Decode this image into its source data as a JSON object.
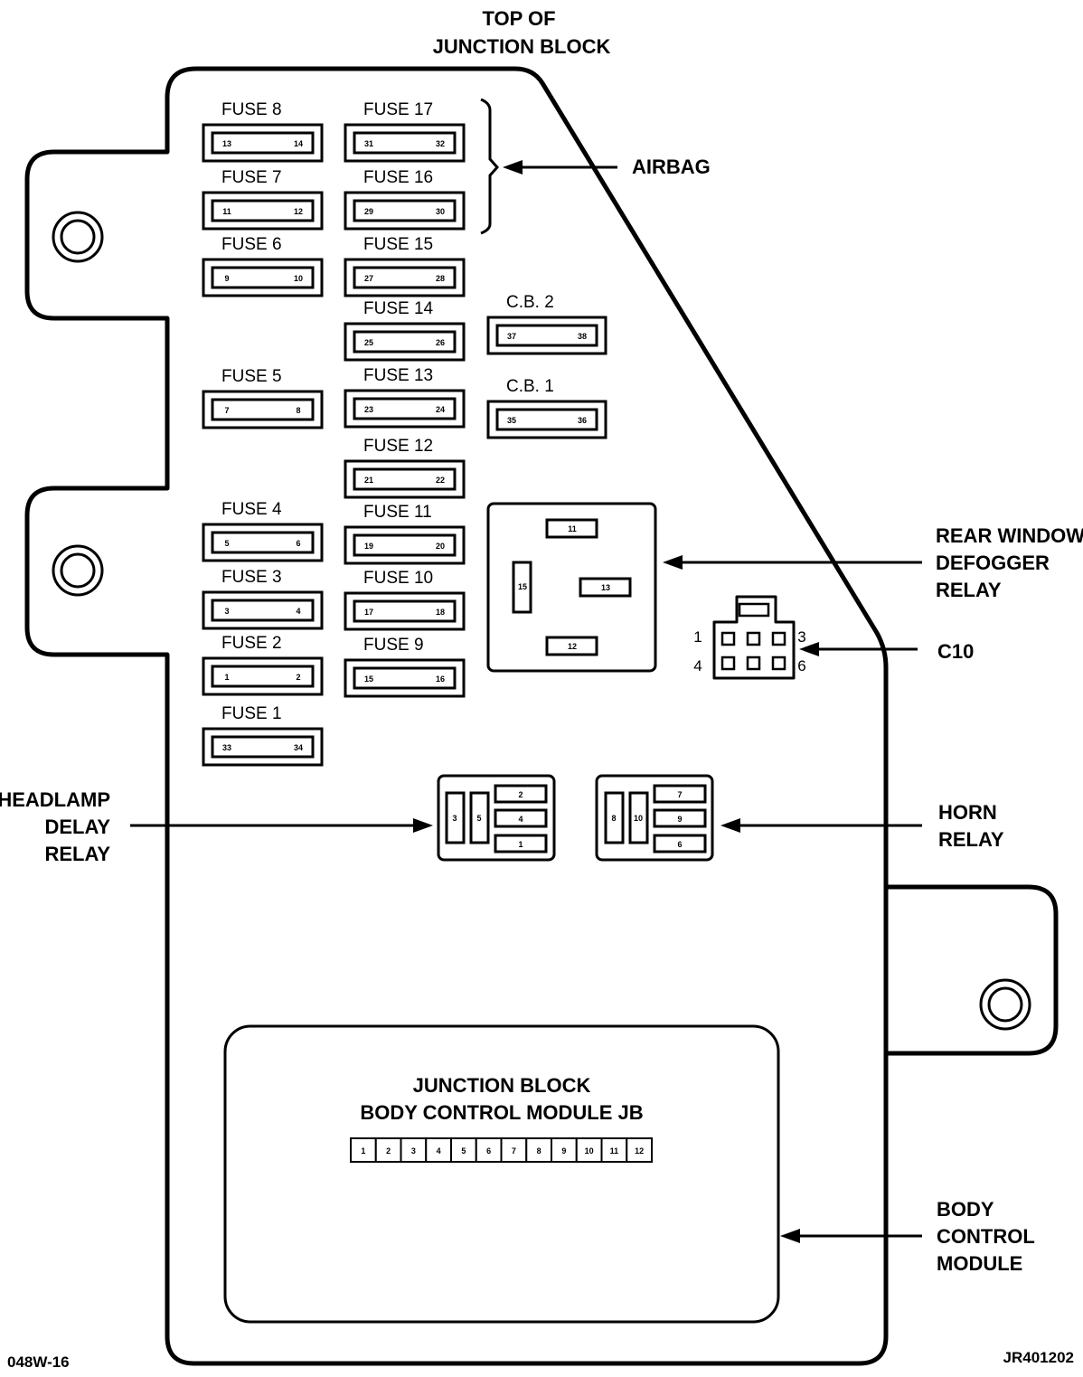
{
  "header": {
    "title_line1": "TOP OF",
    "title_line2": "JUNCTION BLOCK"
  },
  "fuses": [
    {
      "id": "fuse-8",
      "label": "FUSE 8",
      "pins": [
        "13",
        "14"
      ]
    },
    {
      "id": "fuse-7",
      "label": "FUSE 7",
      "pins": [
        "11",
        "12"
      ]
    },
    {
      "id": "fuse-6",
      "label": "FUSE 6",
      "pins": [
        "9",
        "10"
      ]
    },
    {
      "id": "fuse-5",
      "label": "FUSE 5",
      "pins": [
        "7",
        "8"
      ]
    },
    {
      "id": "fuse-4",
      "label": "FUSE 4",
      "pins": [
        "5",
        "6"
      ]
    },
    {
      "id": "fuse-3",
      "label": "FUSE 3",
      "pins": [
        "3",
        "4"
      ]
    },
    {
      "id": "fuse-2",
      "label": "FUSE 2",
      "pins": [
        "1",
        "2"
      ]
    },
    {
      "id": "fuse-1",
      "label": "FUSE 1",
      "pins": [
        "33",
        "34"
      ]
    },
    {
      "id": "fuse-17",
      "label": "FUSE 17",
      "pins": [
        "31",
        "32"
      ]
    },
    {
      "id": "fuse-16",
      "label": "FUSE 16",
      "pins": [
        "29",
        "30"
      ]
    },
    {
      "id": "fuse-15",
      "label": "FUSE 15",
      "pins": [
        "27",
        "28"
      ]
    },
    {
      "id": "fuse-14",
      "label": "FUSE 14",
      "pins": [
        "25",
        "26"
      ]
    },
    {
      "id": "fuse-13",
      "label": "FUSE 13",
      "pins": [
        "23",
        "24"
      ]
    },
    {
      "id": "fuse-12",
      "label": "FUSE 12",
      "pins": [
        "21",
        "22"
      ]
    },
    {
      "id": "fuse-11",
      "label": "FUSE 11",
      "pins": [
        "19",
        "20"
      ]
    },
    {
      "id": "fuse-10",
      "label": "FUSE 10",
      "pins": [
        "17",
        "18"
      ]
    },
    {
      "id": "fuse-9",
      "label": "FUSE 9",
      "pins": [
        "15",
        "16"
      ]
    },
    {
      "id": "cb-2",
      "label": "C.B. 2",
      "pins": [
        "37",
        "38"
      ]
    },
    {
      "id": "cb-1",
      "label": "C.B. 1",
      "pins": [
        "35",
        "36"
      ]
    }
  ],
  "rear_defogger_relay": {
    "pins": {
      "top": "11",
      "left": "15",
      "right": "13",
      "bottom": "12"
    }
  },
  "headlamp_relay": {
    "tall_pins": [
      "3",
      "5"
    ],
    "flat_pins": [
      "2",
      "4",
      "1"
    ]
  },
  "horn_relay": {
    "tall_pins": [
      "8",
      "10"
    ],
    "flat_pins": [
      "7",
      "9",
      "6"
    ]
  },
  "c10": {
    "pin_labels": {
      "top_left": "1",
      "top_right": "3",
      "bottom_left": "4",
      "bottom_right": "6"
    }
  },
  "bcm": {
    "title_line1": "JUNCTION BLOCK",
    "title_line2": "BODY CONTROL MODULE JB",
    "pins": [
      "1",
      "2",
      "3",
      "4",
      "5",
      "6",
      "7",
      "8",
      "9",
      "10",
      "11",
      "12"
    ]
  },
  "callouts": {
    "airbag": [
      "AIRBAG"
    ],
    "rear_defogger": [
      "REAR WINDOW",
      "DEFOGGER",
      "RELAY"
    ],
    "c10": [
      "C10"
    ],
    "headlamp": [
      "HEADLAMP",
      "DELAY",
      "RELAY"
    ],
    "horn": [
      "HORN",
      "RELAY"
    ],
    "bcm": [
      "BODY",
      "CONTROL",
      "MODULE"
    ]
  },
  "footer": {
    "left_code": "048W-16",
    "right_code": "JR401202"
  }
}
